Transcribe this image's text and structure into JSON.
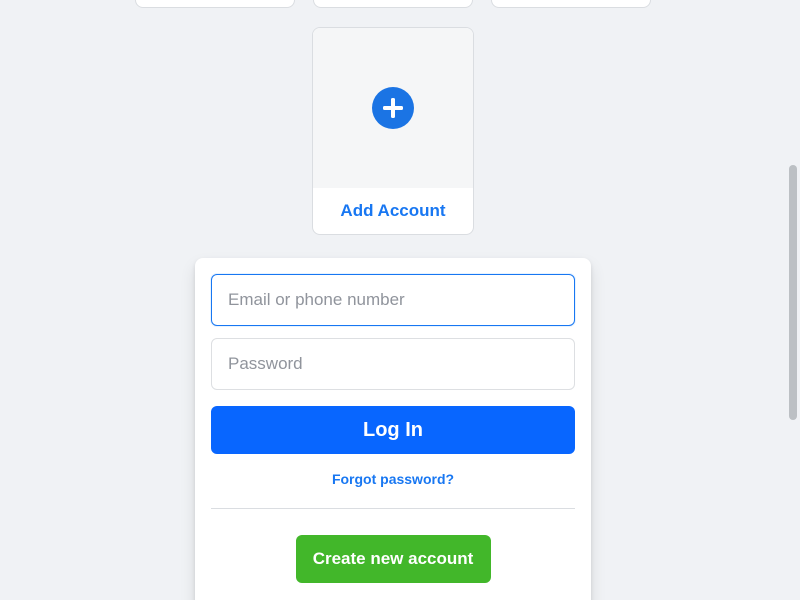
{
  "add_account": {
    "label": "Add Account",
    "icon": "plus-circle-icon",
    "icon_color": "#1b74e4"
  },
  "login": {
    "email_placeholder": "Email or phone number",
    "email_value": "",
    "password_placeholder": "Password",
    "password_value": "",
    "login_label": "Log In",
    "forgot_label": "Forgot password?",
    "create_label": "Create new account"
  },
  "colors": {
    "primary": "#0866ff",
    "link": "#1877f2",
    "create": "#42b72a",
    "background": "#f0f2f5"
  }
}
